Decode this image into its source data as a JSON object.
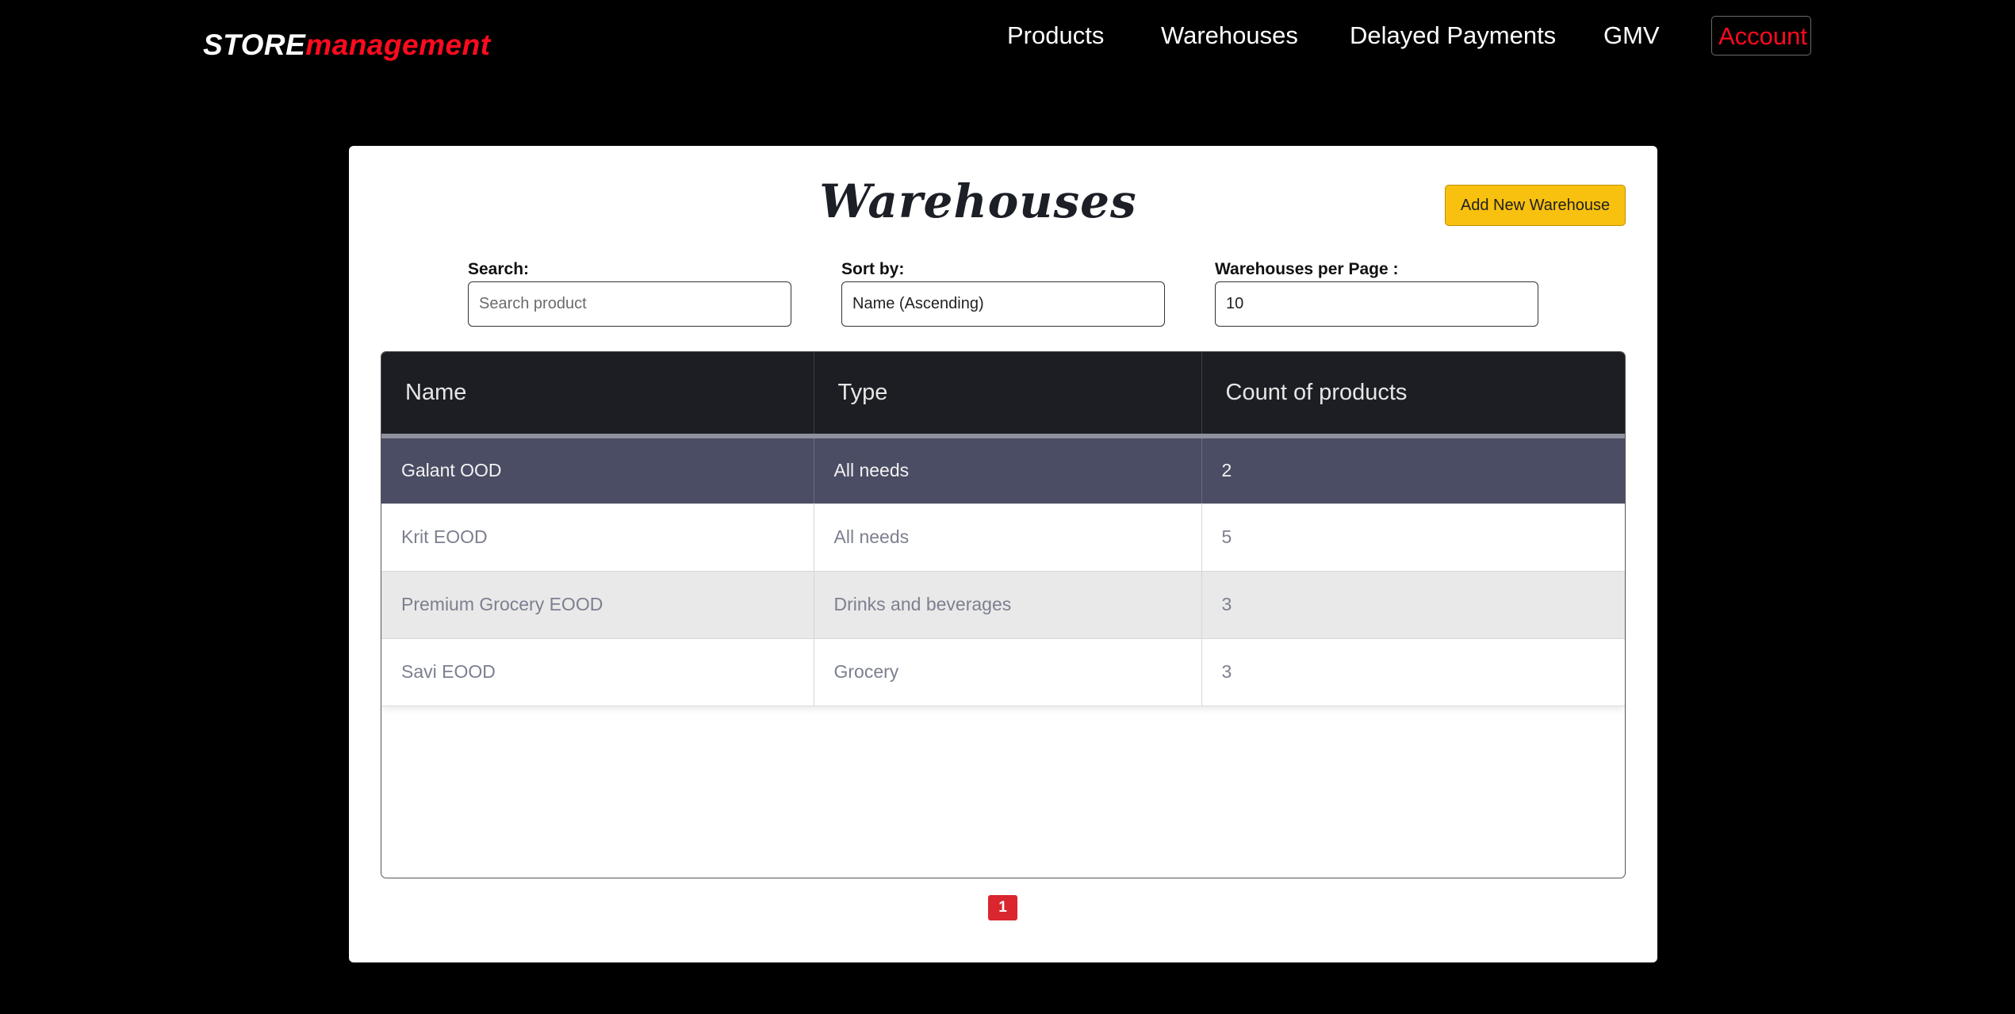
{
  "brand": {
    "store": "STORE",
    "management": "management"
  },
  "nav": {
    "products": "Products",
    "warehouses": "Warehouses",
    "delayed_payments": "Delayed Payments",
    "gmv": "GMV",
    "account": "Account"
  },
  "page": {
    "title": "Warehouses",
    "add_button": "Add New Warehouse"
  },
  "filters": {
    "search_label": "Search:",
    "search_placeholder": "Search product",
    "search_value": "",
    "sort_label": "Sort by:",
    "sort_value": "Name (Ascending)",
    "per_page_label": "Warehouses per Page :",
    "per_page_value": "10"
  },
  "table": {
    "columns": [
      "Name",
      "Type",
      "Count of products"
    ],
    "rows": [
      {
        "name": "Galant OOD",
        "type": "All needs",
        "count": "2"
      },
      {
        "name": "Krit EOOD",
        "type": "All needs",
        "count": "5"
      },
      {
        "name": "Premium Grocery EOOD",
        "type": "Drinks and beverages",
        "count": "3"
      },
      {
        "name": "Savi EOOD",
        "type": "Grocery",
        "count": "3"
      }
    ]
  },
  "pagination": {
    "current": "1"
  },
  "colors": {
    "brand_red": "#ff0a1e",
    "accent_yellow": "#f8c10f",
    "header_dark": "#1d1e24",
    "active_row": "#4b4d64",
    "page_red": "#d9262f"
  }
}
